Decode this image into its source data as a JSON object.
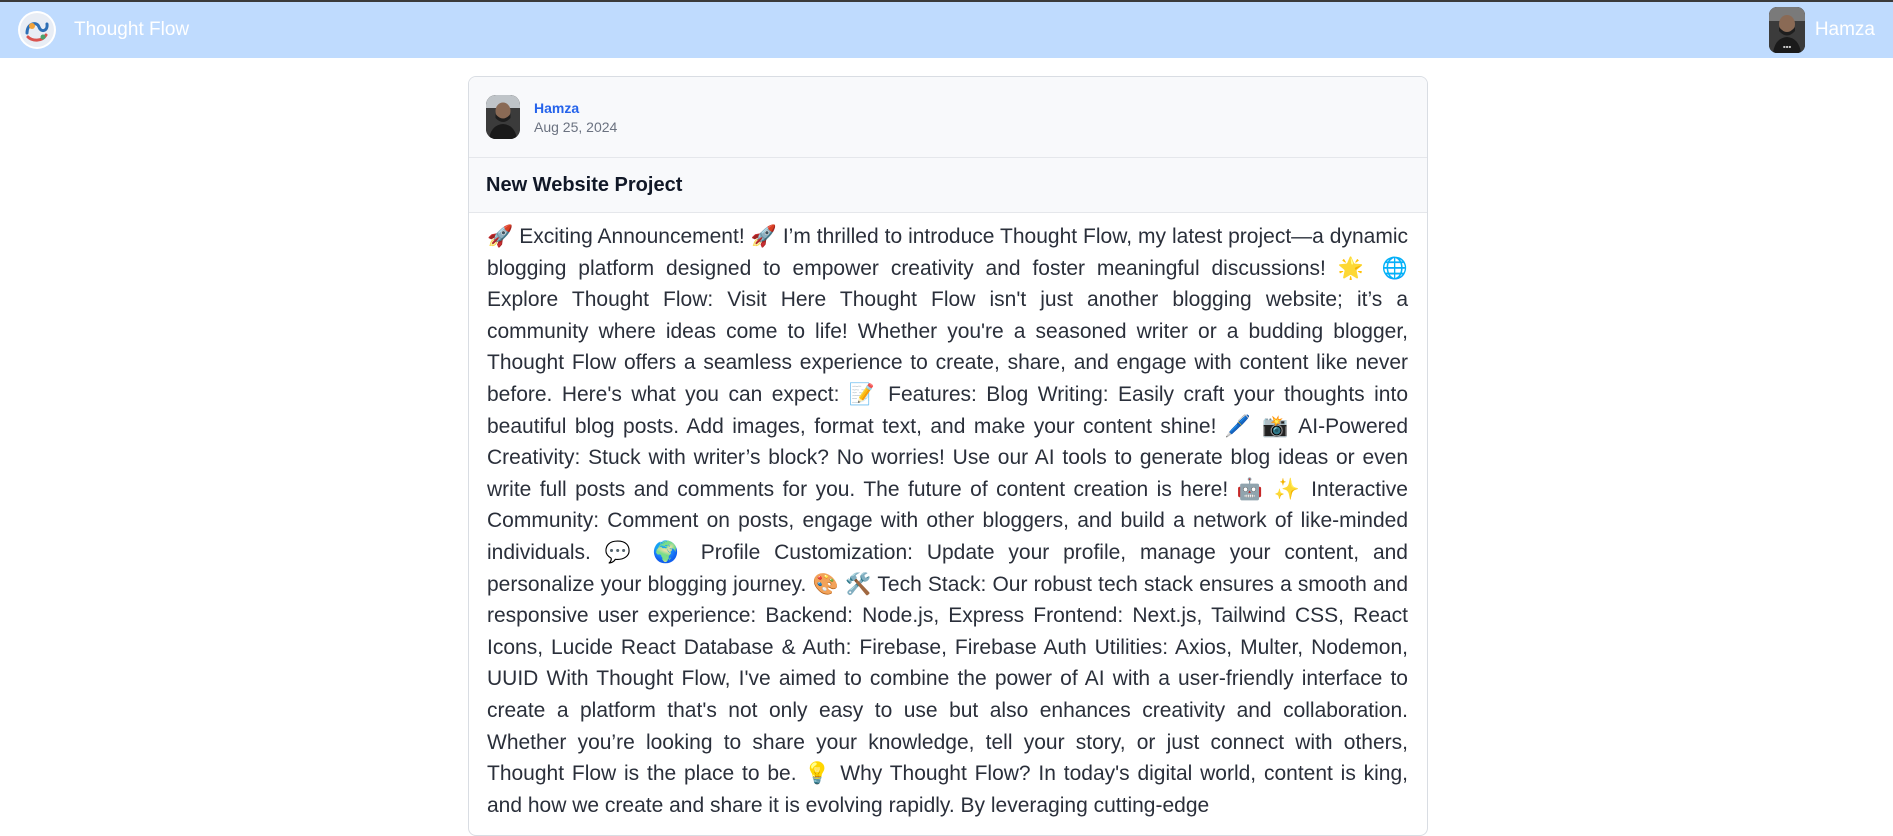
{
  "navbar": {
    "brand_name": "Thought Flow",
    "username": "Hamza"
  },
  "post": {
    "author": "Hamza",
    "date": "Aug 25, 2024",
    "title": "New Website Project",
    "body": "🚀 Exciting Announcement! 🚀 I’m thrilled to introduce Thought Flow, my latest project—a dynamic blogging platform designed to empower creativity and foster meaningful discussions! 🌟 🌐 Explore Thought Flow: Visit Here Thought Flow isn't just another blogging website; it’s a community where ideas come to life! Whether you're a seasoned writer or a budding blogger, Thought Flow offers a seamless experience to create, share, and engage with content like never before. Here's what you can expect: 📝 Features: Blog Writing: Easily craft your thoughts into beautiful blog posts. Add images, format text, and make your content shine! 🖊️ 📸 AI-Powered Creativity: Stuck with writer’s block? No worries! Use our AI tools to generate blog ideas or even write full posts and comments for you. The future of content creation is here! 🤖 ✨ Interactive Community: Comment on posts, engage with other bloggers, and build a network of like-minded individuals. 💬 🌍 Profile Customization: Update your profile, manage your content, and personalize your blogging journey. 🎨 🛠️ Tech Stack: Our robust tech stack ensures a smooth and responsive user experience: Backend: Node.js, Express Frontend: Next.js, Tailwind CSS, React Icons, Lucide React Database & Auth: Firebase, Firebase Auth Utilities: Axios, Multer, Nodemon, UUID With Thought Flow, I've aimed to combine the power of AI with a user-friendly interface to create a platform that's not only easy to use but also enhances creativity and collaboration. Whether you’re looking to share your knowledge, tell your story, or just connect with others, Thought Flow is the place to be. 💡 Why Thought Flow? In today's digital world, content is king, and how we create and share it is evolving rapidly. By leveraging cutting-edge"
  },
  "colors": {
    "navbar_bg": "#bfdbfe",
    "author_link": "#2563eb"
  },
  "icons": {
    "logo": "thought-flow-logo-icon",
    "avatar": "user-avatar"
  }
}
